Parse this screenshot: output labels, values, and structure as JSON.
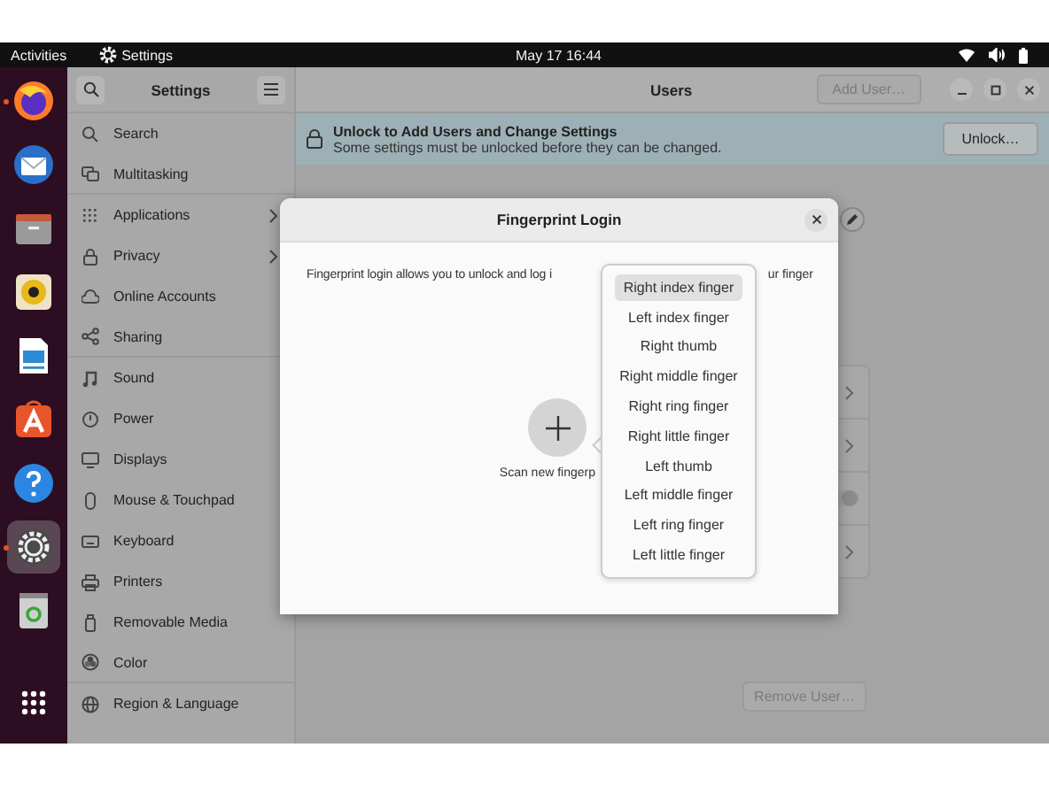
{
  "top_bar": {
    "activities": "Activities",
    "app_name": "Settings",
    "clock": "May 17  16:44"
  },
  "dock": [
    {
      "kind": "firefox",
      "running": true,
      "active": false
    },
    {
      "kind": "mail",
      "running": false,
      "active": false
    },
    {
      "kind": "files",
      "running": false,
      "active": false
    },
    {
      "kind": "music",
      "running": false,
      "active": false
    },
    {
      "kind": "writer",
      "running": false,
      "active": false
    },
    {
      "kind": "store",
      "running": false,
      "active": false
    },
    {
      "kind": "help",
      "running": false,
      "active": false
    },
    {
      "kind": "settings",
      "running": true,
      "active": true
    },
    {
      "kind": "trash",
      "running": false,
      "active": false
    }
  ],
  "sidebar": {
    "title": "Settings",
    "items": [
      {
        "label": "Search",
        "chevron": false
      },
      {
        "label": "Multitasking",
        "chevron": false
      },
      {
        "label": "Applications",
        "chevron": true
      },
      {
        "label": "Privacy",
        "chevron": true
      },
      {
        "label": "Online Accounts",
        "chevron": false
      },
      {
        "label": "Sharing",
        "chevron": false
      },
      {
        "label": "Sound",
        "chevron": false
      },
      {
        "label": "Power",
        "chevron": false
      },
      {
        "label": "Displays",
        "chevron": false
      },
      {
        "label": "Mouse & Touchpad",
        "chevron": false
      },
      {
        "label": "Keyboard",
        "chevron": false
      },
      {
        "label": "Printers",
        "chevron": false
      },
      {
        "label": "Removable Media",
        "chevron": false
      },
      {
        "label": "Color",
        "chevron": false
      },
      {
        "label": "Region & Language",
        "chevron": false
      }
    ]
  },
  "header": {
    "title": "Users",
    "add_user": {
      "label": "Add User…",
      "disabled": true
    }
  },
  "banner": {
    "title": "Unlock to Add Users and Change Settings",
    "subtitle": "Some settings must be unlocked before they can be changed.",
    "button": "Unlock…"
  },
  "settings_rows": [
    {
      "kind": "link"
    },
    {
      "kind": "link"
    },
    {
      "kind": "switch",
      "on": true
    },
    {
      "kind": "link"
    }
  ],
  "remove_user": {
    "label": "Remove User…",
    "disabled": true
  },
  "dialog": {
    "title": "Fingerprint Login",
    "description_start": "Fingerprint login allows you to unlock and log i",
    "description_end": "ur finger",
    "scan_label": "Scan new fingerp",
    "fingers": [
      {
        "label": "Right index finger",
        "selected": true
      },
      {
        "label": "Left index finger",
        "selected": false
      },
      {
        "label": "Right thumb",
        "selected": false
      },
      {
        "label": "Right middle finger",
        "selected": false
      },
      {
        "label": "Right ring finger",
        "selected": false
      },
      {
        "label": "Right little finger",
        "selected": false
      },
      {
        "label": "Left thumb",
        "selected": false
      },
      {
        "label": "Left middle finger",
        "selected": false
      },
      {
        "label": "Left ring finger",
        "selected": false
      },
      {
        "label": "Left little finger",
        "selected": false
      }
    ]
  }
}
